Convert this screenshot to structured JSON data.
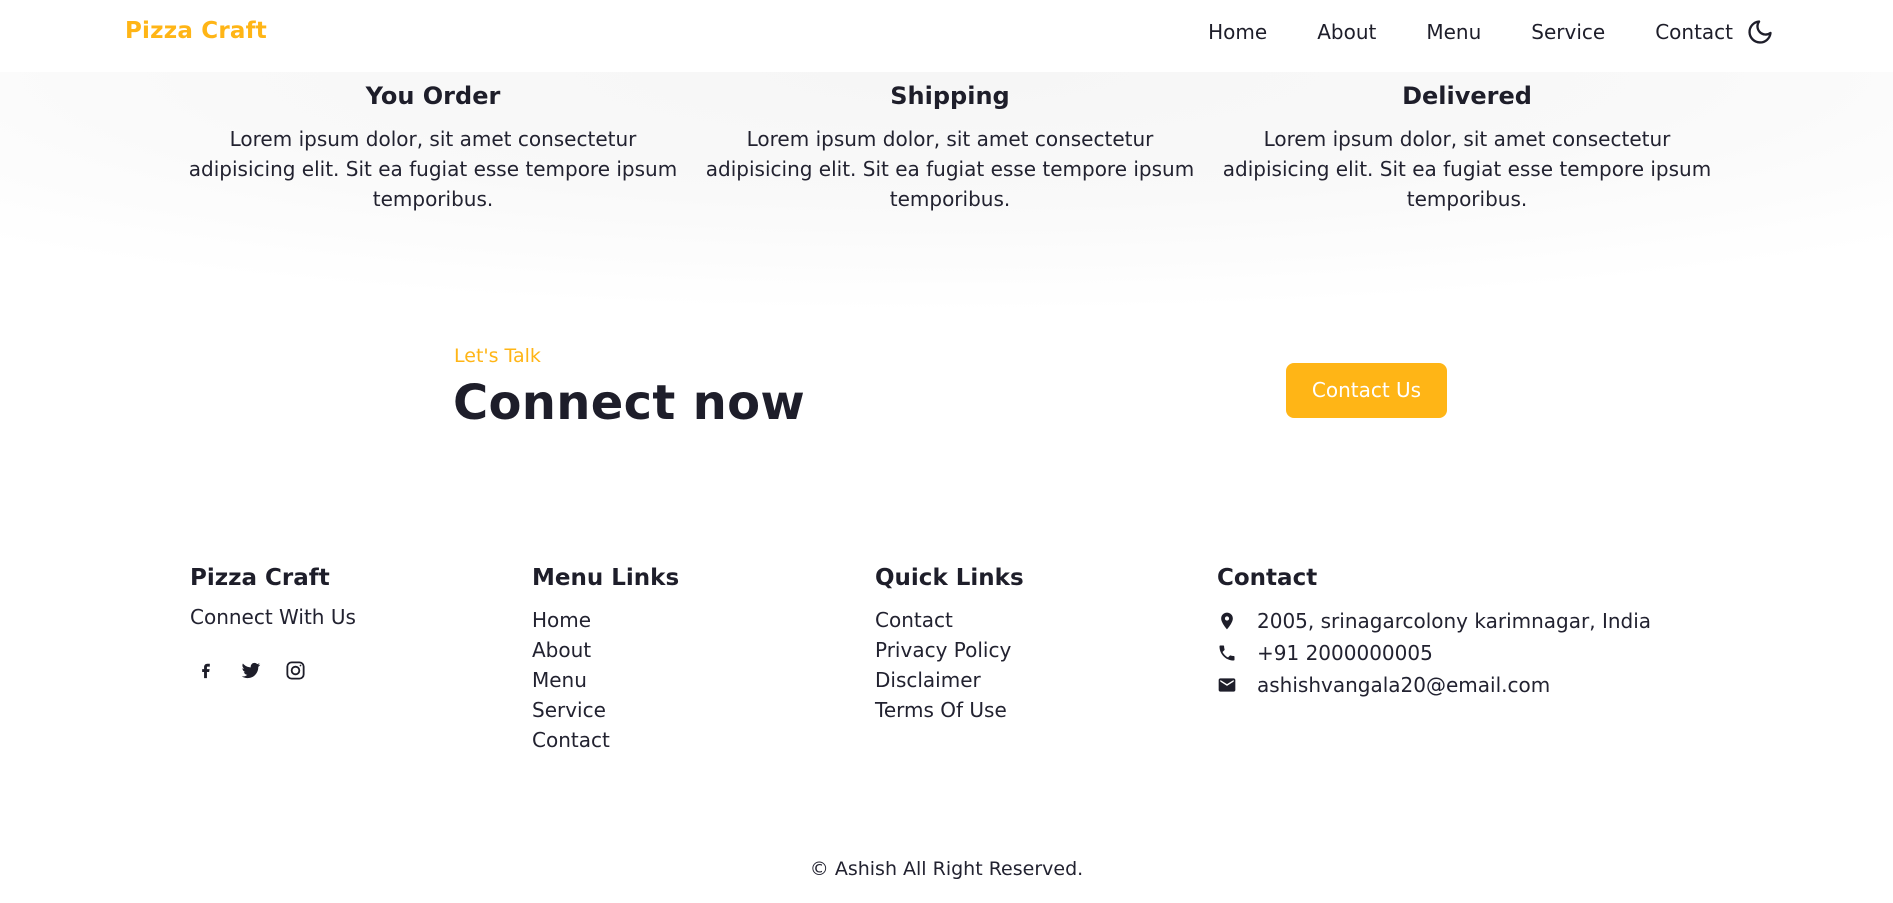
{
  "nav": {
    "brand": "Pizza Craft",
    "links": [
      "Home",
      "About",
      "Menu",
      "Service",
      "Contact"
    ],
    "theme_toggle_icon": "moon-icon"
  },
  "steps": [
    {
      "title": "You Order",
      "text": "Lorem ipsum dolor, sit amet consectetur adipisicing elit. Sit ea fugiat esse tempore ipsum temporibus."
    },
    {
      "title": "Shipping",
      "text": "Lorem ipsum dolor, sit amet consectetur adipisicing elit. Sit ea fugiat esse tempore ipsum temporibus."
    },
    {
      "title": "Delivered",
      "text": "Lorem ipsum dolor, sit amet consectetur adipisicing elit. Sit ea fugiat esse tempore ipsum temporibus."
    }
  ],
  "connect": {
    "label": "Let's Talk",
    "title": "Connect now",
    "button": "Contact Us"
  },
  "footer": {
    "brand": {
      "heading": "Pizza Craft",
      "text": "Connect With Us",
      "socials": [
        "facebook-icon",
        "twitter-icon",
        "instagram-icon"
      ]
    },
    "menu_links": {
      "heading": "Menu Links",
      "items": [
        "Home",
        "About",
        "Menu",
        "Service",
        "Contact"
      ]
    },
    "quick_links": {
      "heading": "Quick Links",
      "items": [
        "Contact",
        "Privacy Policy",
        "Disclaimer",
        "Terms Of Use"
      ]
    },
    "contact": {
      "heading": "Contact",
      "address": "2005, srinagarcolony karimnagar, India",
      "phone": "+91 2000000005",
      "email": "ashishvangala20@email.com"
    },
    "copyright": "© Ashish All Right Reserved."
  },
  "colors": {
    "accent": "#ffb516",
    "text": "#1e1e2a",
    "background": "#ffffff"
  }
}
